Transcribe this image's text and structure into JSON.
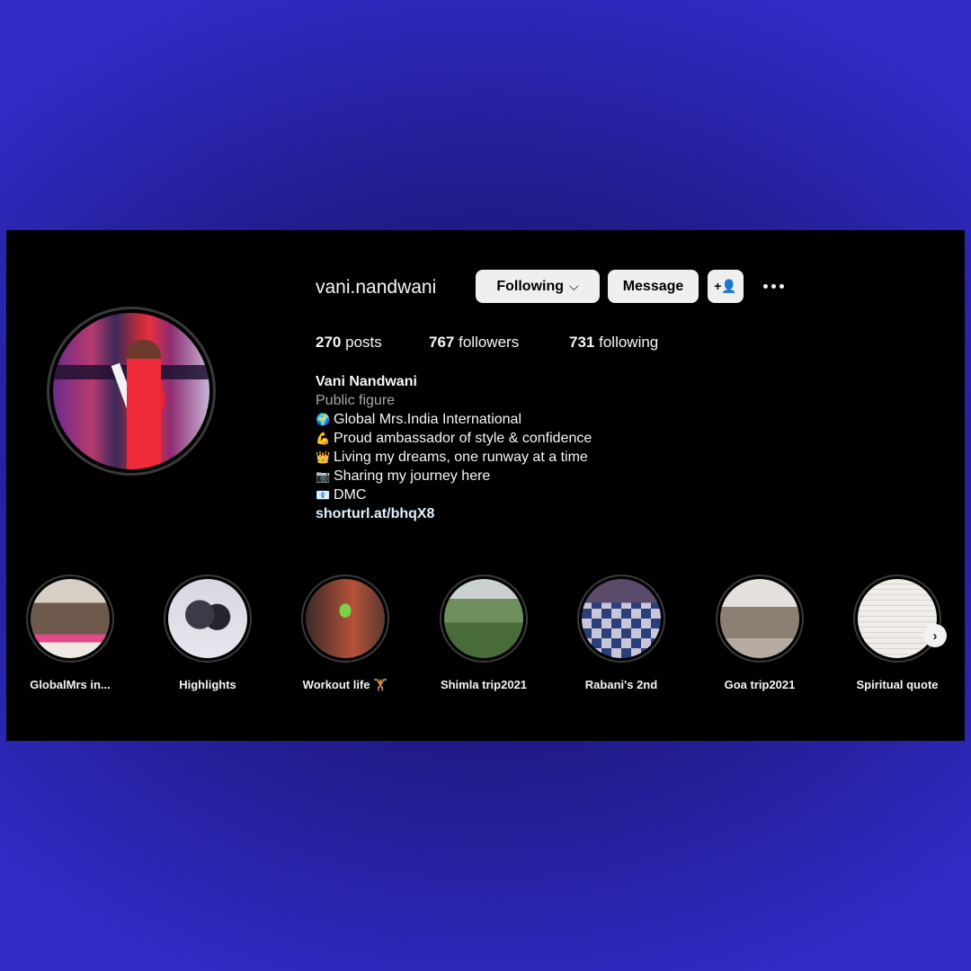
{
  "profile": {
    "username": "vani.nandwani",
    "following_label": "Following",
    "message_label": "Message",
    "add_user_glyph": "+👤",
    "posts_count": "270",
    "posts_label": "posts",
    "followers_count": "767",
    "followers_label": "followers",
    "following_count": "731",
    "following_stat_label": "following"
  },
  "bio": {
    "name": "Vani Nandwani",
    "category": "Public figure",
    "lines": [
      {
        "emoji": "🌍",
        "text": "Global Mrs.India International"
      },
      {
        "emoji": "💪",
        "text": "Proud ambassador of style & confidence"
      },
      {
        "emoji": "👑",
        "text": "Living my dreams, one runway at a time"
      },
      {
        "emoji": "📷",
        "text": "Sharing my journey here"
      },
      {
        "emoji": "📧",
        "text": "DMC"
      }
    ],
    "link": "shorturl.at/bhqX8"
  },
  "highlights": [
    {
      "label": "GlobalMrs in...",
      "color_a": "#6d5a4c",
      "color_b": "#d8cfc4"
    },
    {
      "label": "Highlights",
      "color_a": "#3b3b48",
      "color_b": "#e9e6ef"
    },
    {
      "label": "Workout life 🏋",
      "color_a": "#3a2a28",
      "color_b": "#b5523a"
    },
    {
      "label": "Shimla trip2021",
      "color_a": "#496b3a",
      "color_b": "#c9d2cf"
    },
    {
      "label": "Rabani's 2nd",
      "color_a": "#2b3f7a",
      "color_b": "#c9c6d9"
    },
    {
      "label": "Goa trip2021",
      "color_a": "#8d7f72",
      "color_b": "#e4e0dc"
    },
    {
      "label": "Spiritual quote",
      "color_a": "#d9d4cc",
      "color_b": "#f1eee9"
    }
  ],
  "next_glyph": "›"
}
